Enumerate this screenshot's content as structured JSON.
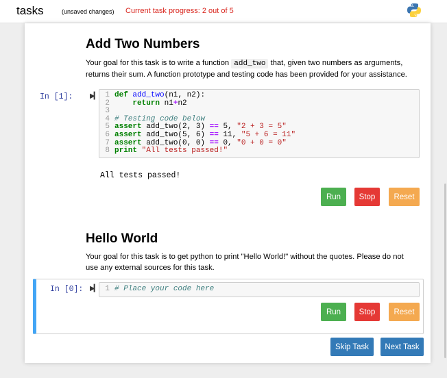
{
  "header": {
    "app_name": "tasks",
    "unsaved": "(unsaved changes)",
    "progress": "Current task progress: 2 out of 5",
    "logo_icon": "python-logo-icon"
  },
  "task1": {
    "title": "Add Two Numbers",
    "desc_before": "Your goal for this task is to write a function ",
    "desc_code": "add_two",
    "desc_after": " that, given two numbers as arguments, returns their sum. A function prototype and testing code has been provided for your assistance.",
    "prompt": "In [1]:",
    "code_lines": [
      "def add_two(n1, n2):",
      "    return n1+n2",
      "",
      "# Testing code below",
      "assert add_two(2, 3) == 5, \"2 + 3 = 5\"",
      "assert add_two(5, 6) == 11, \"5 + 6 = 11\"",
      "assert add_two(0, 0) == 0, \"0 + 0 = 0\"",
      "print \"All tests passed!\""
    ],
    "output": "All tests passed!",
    "run_label": "Run",
    "stop_label": "Stop",
    "reset_label": "Reset"
  },
  "task2": {
    "title": "Hello World",
    "desc": "Your goal for this task is to get python to print \"Hello World!\" without the quotes. Please do not use any external sources for this task.",
    "prompt": "In [0]:",
    "code_lines": [
      "# Place your code here"
    ],
    "run_label": "Run",
    "stop_label": "Stop",
    "reset_label": "Reset"
  },
  "footer": {
    "skip_label": "Skip Task",
    "next_label": "Next Task"
  },
  "colors": {
    "accent_blue": "#337ab7",
    "run_green": "#4caf50",
    "stop_red": "#e53935",
    "reset_orange": "#f4a950",
    "progress_red": "#d9251d",
    "selected_cell": "#42a5f5"
  }
}
